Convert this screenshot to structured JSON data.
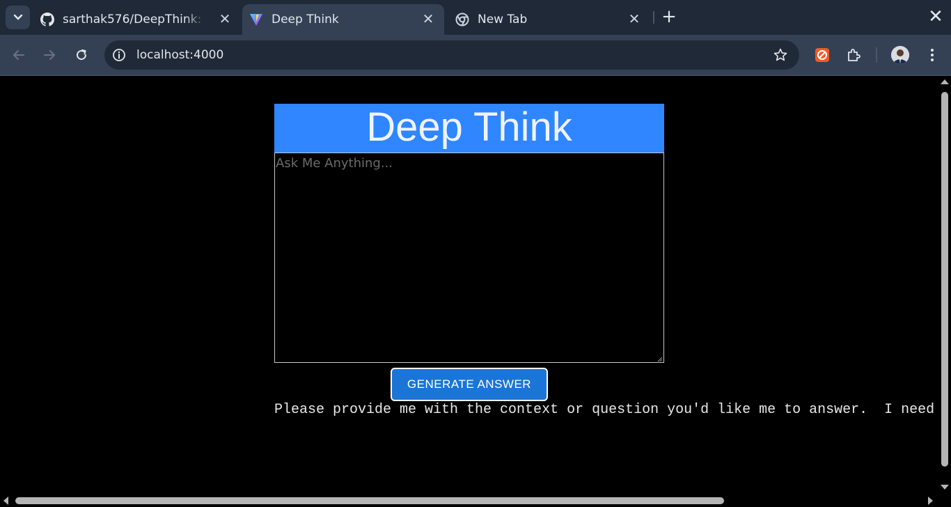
{
  "browser": {
    "tabs": [
      {
        "title": "sarthak576/DeepThink: c",
        "favicon": "github-icon",
        "active": false
      },
      {
        "title": "Deep Think",
        "favicon": "vite-icon",
        "active": true
      },
      {
        "title": "New Tab",
        "favicon": "chrome-icon",
        "active": false
      }
    ],
    "new_tab_label": "+",
    "close_label": "✕",
    "address": "localhost:4000"
  },
  "app": {
    "title": "Deep Think",
    "question_placeholder": "Ask Me Anything...",
    "question_value": "",
    "generate_label": "GENERATE ANSWER",
    "answer": "Please provide me with the context or question you'd like me to answer.  I need"
  },
  "colors": {
    "header_bg": "#2f86ff",
    "button_bg": "#1b75d6",
    "page_bg": "#000000",
    "chrome_dark": "#1f2937",
    "chrome_mid": "#344155"
  }
}
